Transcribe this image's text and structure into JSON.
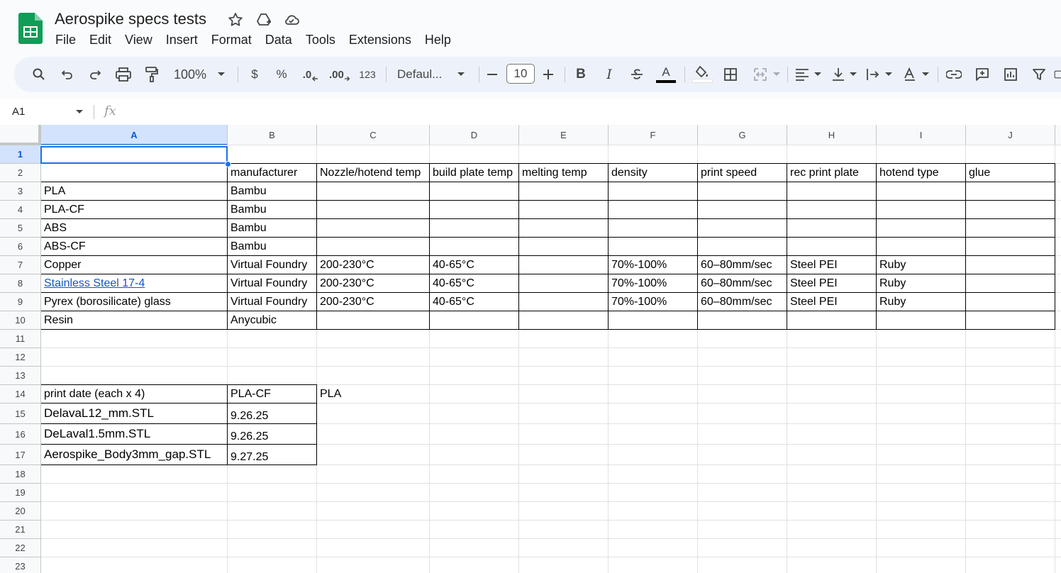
{
  "app": {
    "doc_title": "Aerospike specs tests",
    "menu": [
      "File",
      "Edit",
      "View",
      "Insert",
      "Format",
      "Data",
      "Tools",
      "Extensions",
      "Help"
    ]
  },
  "toolbar": {
    "zoom": "100%",
    "currency": "$",
    "percent": "%",
    "dec_decrease": ".0",
    "dec_increase": ".00",
    "number_format": "123",
    "font": "Defaul...",
    "font_size": "10",
    "bold": "B",
    "italic": "I",
    "text_color_letter": "A"
  },
  "formula_bar": {
    "name_box": "A1",
    "fx": "fx",
    "value": ""
  },
  "columns": [
    "A",
    "B",
    "C",
    "D",
    "E",
    "F",
    "G",
    "H",
    "I",
    "J"
  ],
  "rows": [
    "1",
    "2",
    "3",
    "4",
    "5",
    "6",
    "7",
    "8",
    "9",
    "10",
    "11",
    "12",
    "13",
    "14",
    "15",
    "16",
    "17",
    "18",
    "19",
    "20",
    "21",
    "22",
    "23"
  ],
  "table1": {
    "header": [
      "",
      "manufacturer",
      "Nozzle/hotend temp",
      "build plate temp",
      "melting temp",
      "density",
      "print speed",
      "rec print plate",
      "hotend type",
      "glue"
    ],
    "rows": [
      [
        "PLA",
        "Bambu",
        "",
        "",
        "",
        "",
        "",
        "",
        "",
        ""
      ],
      [
        "PLA-CF",
        "Bambu",
        "",
        "",
        "",
        "",
        "",
        "",
        "",
        ""
      ],
      [
        "ABS",
        "Bambu",
        "",
        "",
        "",
        "",
        "",
        "",
        "",
        ""
      ],
      [
        "ABS-CF",
        "Bambu",
        "",
        "",
        "",
        "",
        "",
        "",
        "",
        ""
      ],
      [
        "Copper",
        "Virtual Foundry",
        "200-230°C",
        "40-65°C",
        "",
        "70%-100%",
        "60–80mm/sec",
        "Steel PEI",
        "Ruby",
        ""
      ],
      [
        "Stainless Steel 17-4",
        "Virtual Foundry",
        "200-230°C",
        "40-65°C",
        "",
        "70%-100%",
        "60–80mm/sec",
        "Steel PEI",
        "Ruby",
        ""
      ],
      [
        "Pyrex (borosilicate) glass",
        "Virtual Foundry",
        "200-230°C",
        "40-65°C",
        "",
        "70%-100%",
        "60–80mm/sec",
        "Steel PEI",
        "Ruby",
        ""
      ],
      [
        "Resin",
        "Anycubic",
        "",
        "",
        "",
        "",
        "",
        "",
        "",
        ""
      ]
    ]
  },
  "table2": {
    "header": [
      "print date (each x 4)",
      "PLA-CF",
      "PLA"
    ],
    "rows": [
      [
        "DelavaL12_mm.STL",
        "9.26.25"
      ],
      [
        "DeLaval1.5mm.STL",
        "9.26.25"
      ],
      [
        "Aerospike_Body3mm_gap.STL",
        "9.27.25"
      ]
    ]
  },
  "colors": {
    "accent": "#0b57d0",
    "selection": "#1a73e8",
    "link": "#1155cc",
    "sheets_green": "#0f9d58"
  }
}
